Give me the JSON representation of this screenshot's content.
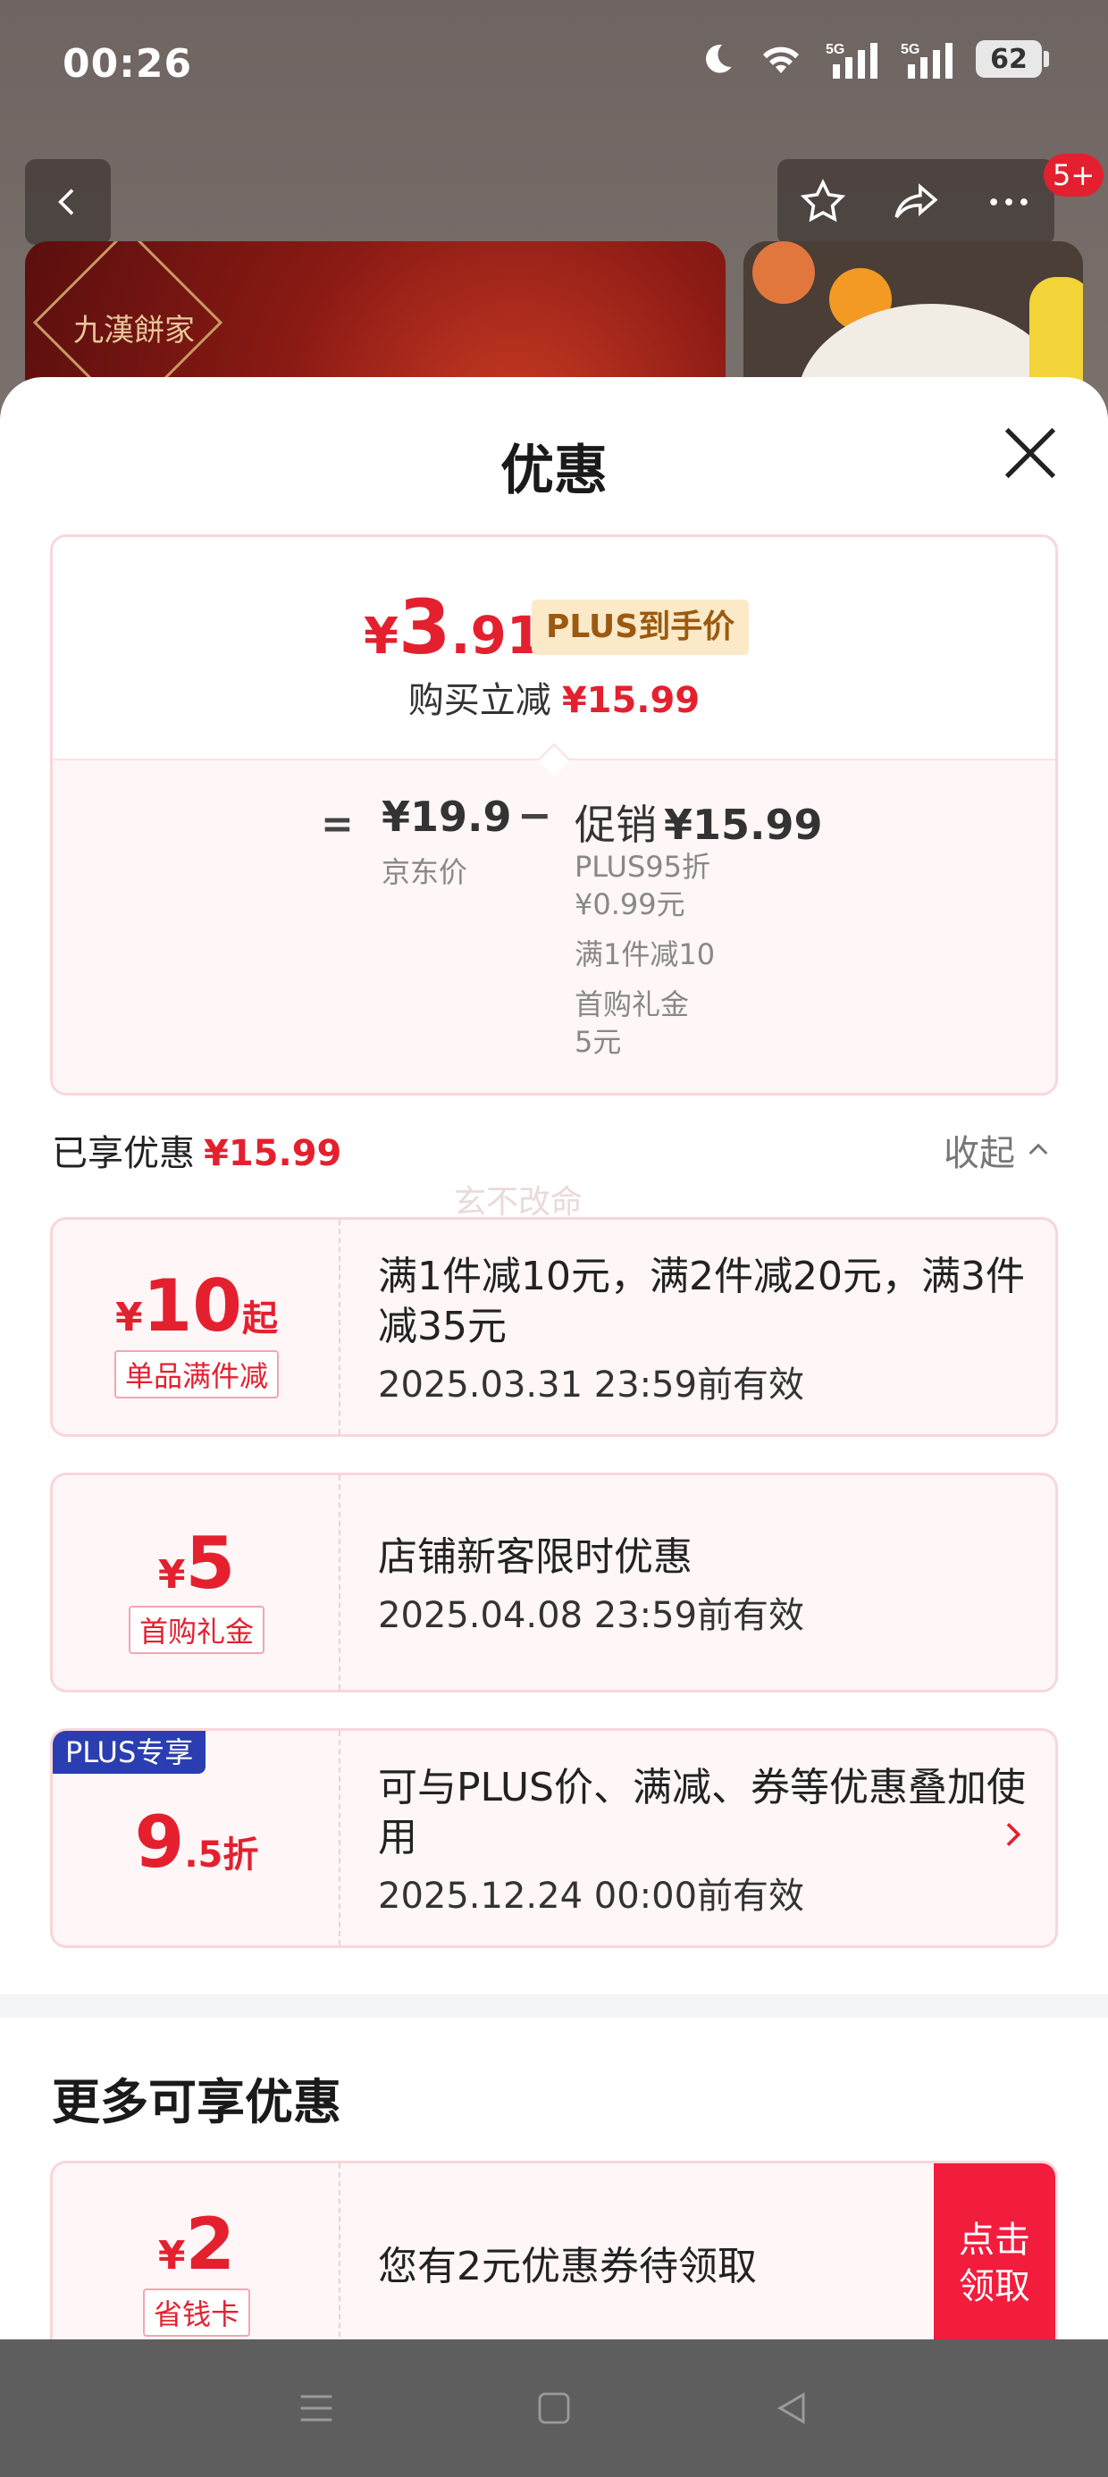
{
  "status_bar": {
    "time": "00:26",
    "battery": "62"
  },
  "top_nav": {
    "badge": "5+"
  },
  "hero": {
    "logo_text": "九漢餅家"
  },
  "sheet": {
    "title": "优惠",
    "price_card": {
      "symbol": "¥",
      "price_int": "3",
      "price_dec": ".91",
      "plus_tag": "PLUS到手价",
      "reduce_label": "购买立减",
      "reduce_value": "¥15.99",
      "equals": "=",
      "jd_price": "¥19.9",
      "jd_price_label": "京东价",
      "minus": "−",
      "promo_label": "促销",
      "promo_value": "¥15.99",
      "details": [
        "PLUS95折",
        "¥0.99元",
        "满1件减10",
        "首购礼金",
        "5元"
      ]
    },
    "enjoyed_label": "已享优惠",
    "enjoyed_value": "¥15.99",
    "collapse_label": "收起",
    "watermark": "玄不改命",
    "coupons": [
      {
        "symbol": "¥",
        "amount": "10",
        "suffix": "起",
        "tag": "单品满件减",
        "desc": "满1件减10元，满2件减20元，满3件减35元",
        "date": "2025.03.31 23:59前有效"
      },
      {
        "symbol": "¥",
        "amount": "5",
        "suffix": "",
        "tag": "首购礼金",
        "desc": "店铺新客限时优惠",
        "date": "2025.04.08 23:59前有效"
      },
      {
        "badge": "PLUS专享",
        "amount": "9",
        "suffix": ".5折",
        "desc": "可与PLUS价、满减、券等优惠叠加使用",
        "date": "2025.12.24 00:00前有效"
      }
    ],
    "more_title": "更多可享优惠",
    "more_coupon": {
      "symbol": "¥",
      "amount": "2",
      "tag": "省钱卡",
      "desc": "您有2元优惠券待领取",
      "claim_line1": "点击",
      "claim_line2": "领取"
    }
  },
  "colors": {
    "accent": "#e4202f",
    "plus_blue": "#2a3eb1",
    "plus_gold_bg": "#fbe9c8",
    "card_bg": "#fff6f7"
  }
}
